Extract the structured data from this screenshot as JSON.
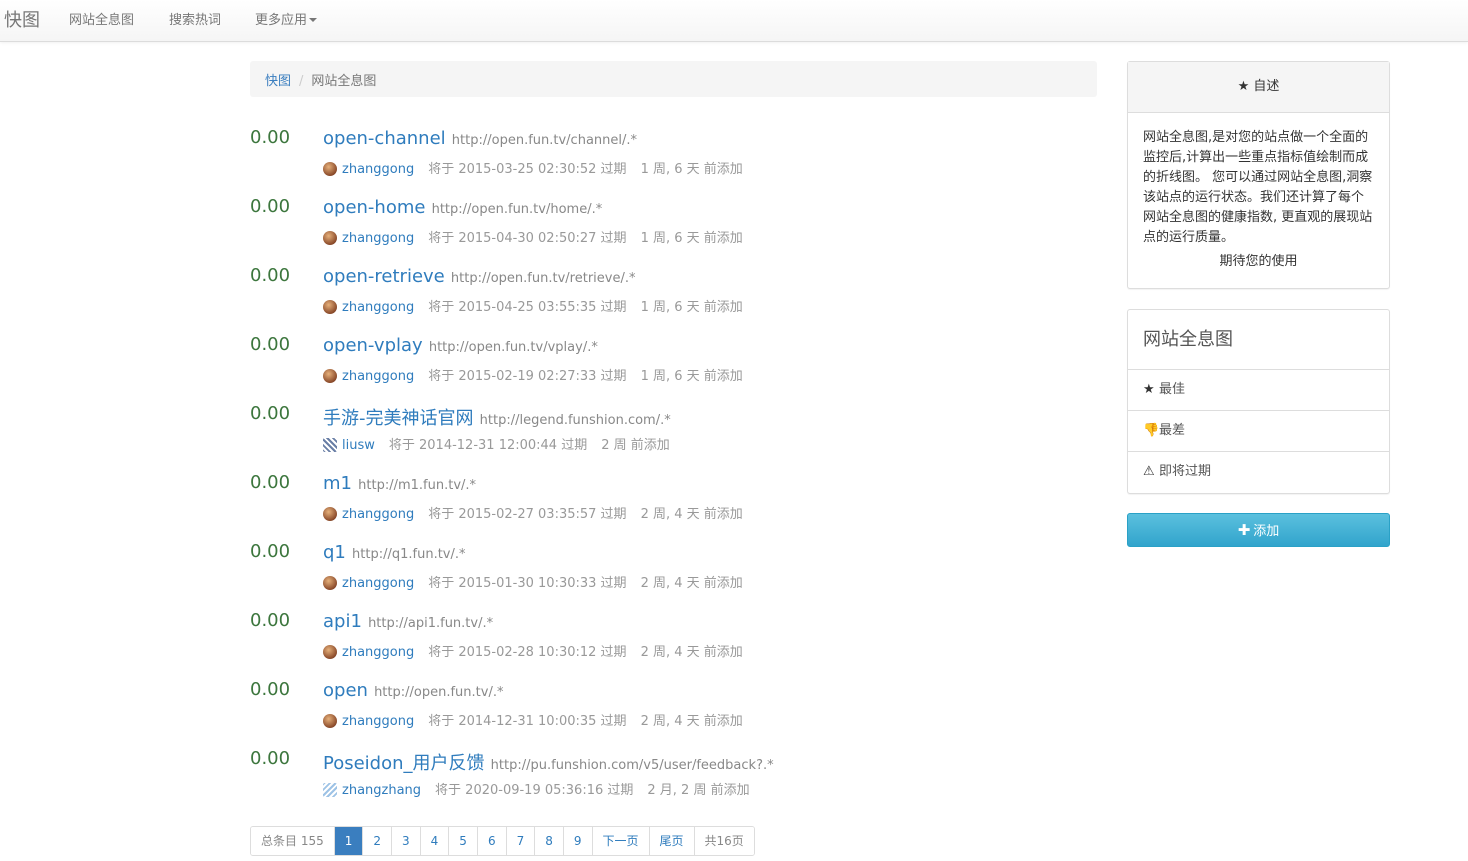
{
  "nav": {
    "brand": "快图",
    "items": [
      "网站全息图",
      "搜索热词",
      "更多应用"
    ]
  },
  "breadcrumb": {
    "home": "快图",
    "sep": "/",
    "current": "网站全息图"
  },
  "entries": [
    {
      "score": "0.00",
      "title": "open-channel",
      "url": "http://open.fun.tv/channel/.*",
      "user": "zhanggong",
      "avatar": "brown",
      "expire": "将于 2015-03-25 02:30:52 过期",
      "added": "1 周, 6 天 前添加"
    },
    {
      "score": "0.00",
      "title": "open-home",
      "url": "http://open.fun.tv/home/.*",
      "user": "zhanggong",
      "avatar": "brown",
      "expire": "将于 2015-04-30 02:50:27 过期",
      "added": "1 周, 6 天 前添加"
    },
    {
      "score": "0.00",
      "title": "open-retrieve",
      "url": "http://open.fun.tv/retrieve/.*",
      "user": "zhanggong",
      "avatar": "brown",
      "expire": "将于 2015-04-25 03:55:35 过期",
      "added": "1 周, 6 天 前添加"
    },
    {
      "score": "0.00",
      "title": "open-vplay",
      "url": "http://open.fun.tv/vplay/.*",
      "user": "zhanggong",
      "avatar": "brown",
      "expire": "将于 2015-02-19 02:27:33 过期",
      "added": "1 周, 6 天 前添加"
    },
    {
      "score": "0.00",
      "title": "手游-完美神话官网",
      "url": "http://legend.funshion.com/.*",
      "user": "liusw",
      "avatar": "pattern",
      "expire": "将于 2014-12-31 12:00:44 过期",
      "added": "2 周 前添加"
    },
    {
      "score": "0.00",
      "title": "m1",
      "url": "http://m1.fun.tv/.*",
      "user": "zhanggong",
      "avatar": "brown",
      "expire": "将于 2015-02-27 03:35:57 过期",
      "added": "2 周, 4 天 前添加"
    },
    {
      "score": "0.00",
      "title": "q1",
      "url": "http://q1.fun.tv/.*",
      "user": "zhanggong",
      "avatar": "brown",
      "expire": "将于 2015-01-30 10:30:33 过期",
      "added": "2 周, 4 天 前添加"
    },
    {
      "score": "0.00",
      "title": "api1",
      "url": "http://api1.fun.tv/.*",
      "user": "zhanggong",
      "avatar": "brown",
      "expire": "将于 2015-02-28 10:30:12 过期",
      "added": "2 周, 4 天 前添加"
    },
    {
      "score": "0.00",
      "title": "open",
      "url": "http://open.fun.tv/.*",
      "user": "zhanggong",
      "avatar": "brown",
      "expire": "将于 2014-12-31 10:00:35 过期",
      "added": "2 周, 4 天 前添加"
    },
    {
      "score": "0.00",
      "title": "Poseidon_用户反馈",
      "url": "http://pu.funshion.com/v5/user/feedback?.*",
      "user": "zhangzhang",
      "avatar": "blue",
      "expire": "将于 2020-09-19 05:36:16 过期",
      "added": "2 月, 2 周 前添加"
    }
  ],
  "pagination": {
    "total": "总条目 155",
    "pages": [
      "1",
      "2",
      "3",
      "4",
      "5",
      "6",
      "7",
      "8",
      "9"
    ],
    "active": "1",
    "next": "下一页",
    "last": "尾页",
    "count": "共16页"
  },
  "about": {
    "title": "自述",
    "text": "网站全息图,是对您的站点做一个全面的监控后,计算出一些重点指标值绘制而成的折线图。 您可以通过网站全息图,洞察该站点的运行状态。我们还计算了每个网站全息图的健康指数, 更直观的展现站点的运行质量。",
    "footer": "期待您的使用"
  },
  "menu": {
    "title": "网站全息图",
    "items": [
      {
        "label": "最佳",
        "icon": "star-icon",
        "glyph": "★"
      },
      {
        "label": "最差",
        "icon": "thumbs-down-icon",
        "glyph": "👎"
      },
      {
        "label": "即将过期",
        "icon": "warning-icon",
        "glyph": "⚠"
      }
    ]
  },
  "add_button": "添加"
}
